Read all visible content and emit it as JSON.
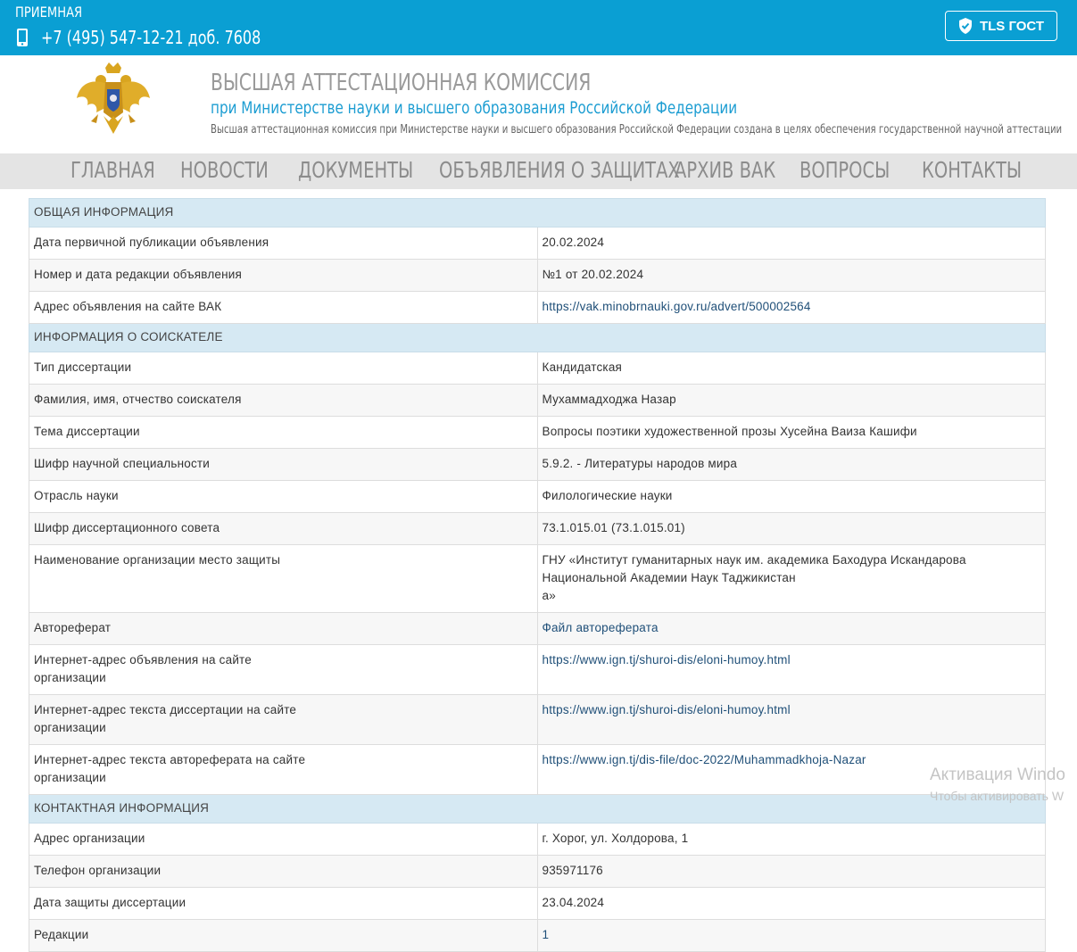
{
  "topbar": {
    "reception": "ПРИЕМНАЯ",
    "phone": "+7 (495) 547-12-21 доб. 7608",
    "tls_label": "TLS ГОСТ",
    "icon_phone": "mobile-phone-icon",
    "icon_tls": "shield-check-icon"
  },
  "header": {
    "title": "ВЫСШАЯ АТТЕСТАЦИОННАЯ КОМИССИЯ",
    "subtitle": "при Министерстве науки и высшего образования Российской Федерации",
    "description": "Высшая аттестационная комиссия при Министерстве науки и высшего образования Российской Федерации создана в целях обеспечения государственной научной аттестации"
  },
  "nav": {
    "items": [
      "Главная",
      "Новости",
      "Документы",
      "Объявления о защитах",
      "Архив ВАК",
      "Вопросы",
      "Контакты"
    ]
  },
  "sections": {
    "general": "ОБЩАЯ ИНФОРМАЦИЯ",
    "applicant": "ИНФОРМАЦИЯ О СОИСКАТЕЛЕ",
    "contact": "КОНТАКТНАЯ ИНФОРМАЦИЯ"
  },
  "general": {
    "pub_date_label": "Дата первичной публикации объявления",
    "pub_date": "20.02.2024",
    "rev_label": "Номер и дата редакции объявления",
    "rev": "№1 от 20.02.2024",
    "url_label": "Адрес объявления на сайте ВАК",
    "url": "https://vak.minobrnauki.gov.ru/advert/500002564"
  },
  "applicant": {
    "type_label": "Тип диссертации",
    "type": "Кандидатская",
    "name_label": "Фамилия, имя, отчество соискателя",
    "name": "Мухаммадходжа Назар",
    "topic_label": "Тема диссертации",
    "topic": "Вопросы поэтики художественной прозы Хусейна Ваиза Кашифи",
    "spec_label": "Шифр научной специальности",
    "spec": "5.9.2. - Литературы народов мира",
    "branch_label": "Отрасль науки",
    "branch": "Филологические науки",
    "council_label": "Шифр диссертационного совета",
    "council": "73.1.015.01 (73.1.015.01)",
    "org_label": "Наименование организации место защиты",
    "org_line1": "ГНУ «Институт гуманитарных наук им. академика Баходура Искандарова Национальной Академии Наук Таджикистан",
    "org_line2": "а»",
    "abstract_label": "Автореферат",
    "abstract": "Файл автореферата",
    "ad_url_label_1": "Интернет-адрес объявления на сайте",
    "ad_url_label_2": "организации",
    "ad_url": "https://www.ign.tj/shuroi-dis/eloni-humoy.html",
    "text_url_label_1": "Интернет-адрес текста диссертации на сайте",
    "text_url_label_2": "организации",
    "text_url": "https://www.ign.tj/shuroi-dis/eloni-humoy.html",
    "abs_url_label_1": "Интернет-адрес текста автореферата на сайте",
    "abs_url_label_2": "организации",
    "abs_url": "https://www.ign.tj/dis-file/doc-2022/Muhammadkhoja-Nazar"
  },
  "contact": {
    "addr_label": "Адрес организации",
    "addr": "г. Хорог, ул. Холдорова, 1",
    "phone_label": "Телефон организации",
    "phone": "935971176",
    "def_date_label": "Дата защиты диссертации",
    "def_date": "23.04.2024",
    "rev_label": "Редакции",
    "rev": "1"
  },
  "watermark": {
    "line1": "Активация Windo",
    "line2": "Чтобы активировать W"
  },
  "colors": {
    "topbar": "#0a9fd3",
    "section_bg": "#d6e9f3",
    "nav_bg": "#e4e4e4",
    "link": "#1f4f78",
    "subtitle": "#1c9dd2"
  }
}
